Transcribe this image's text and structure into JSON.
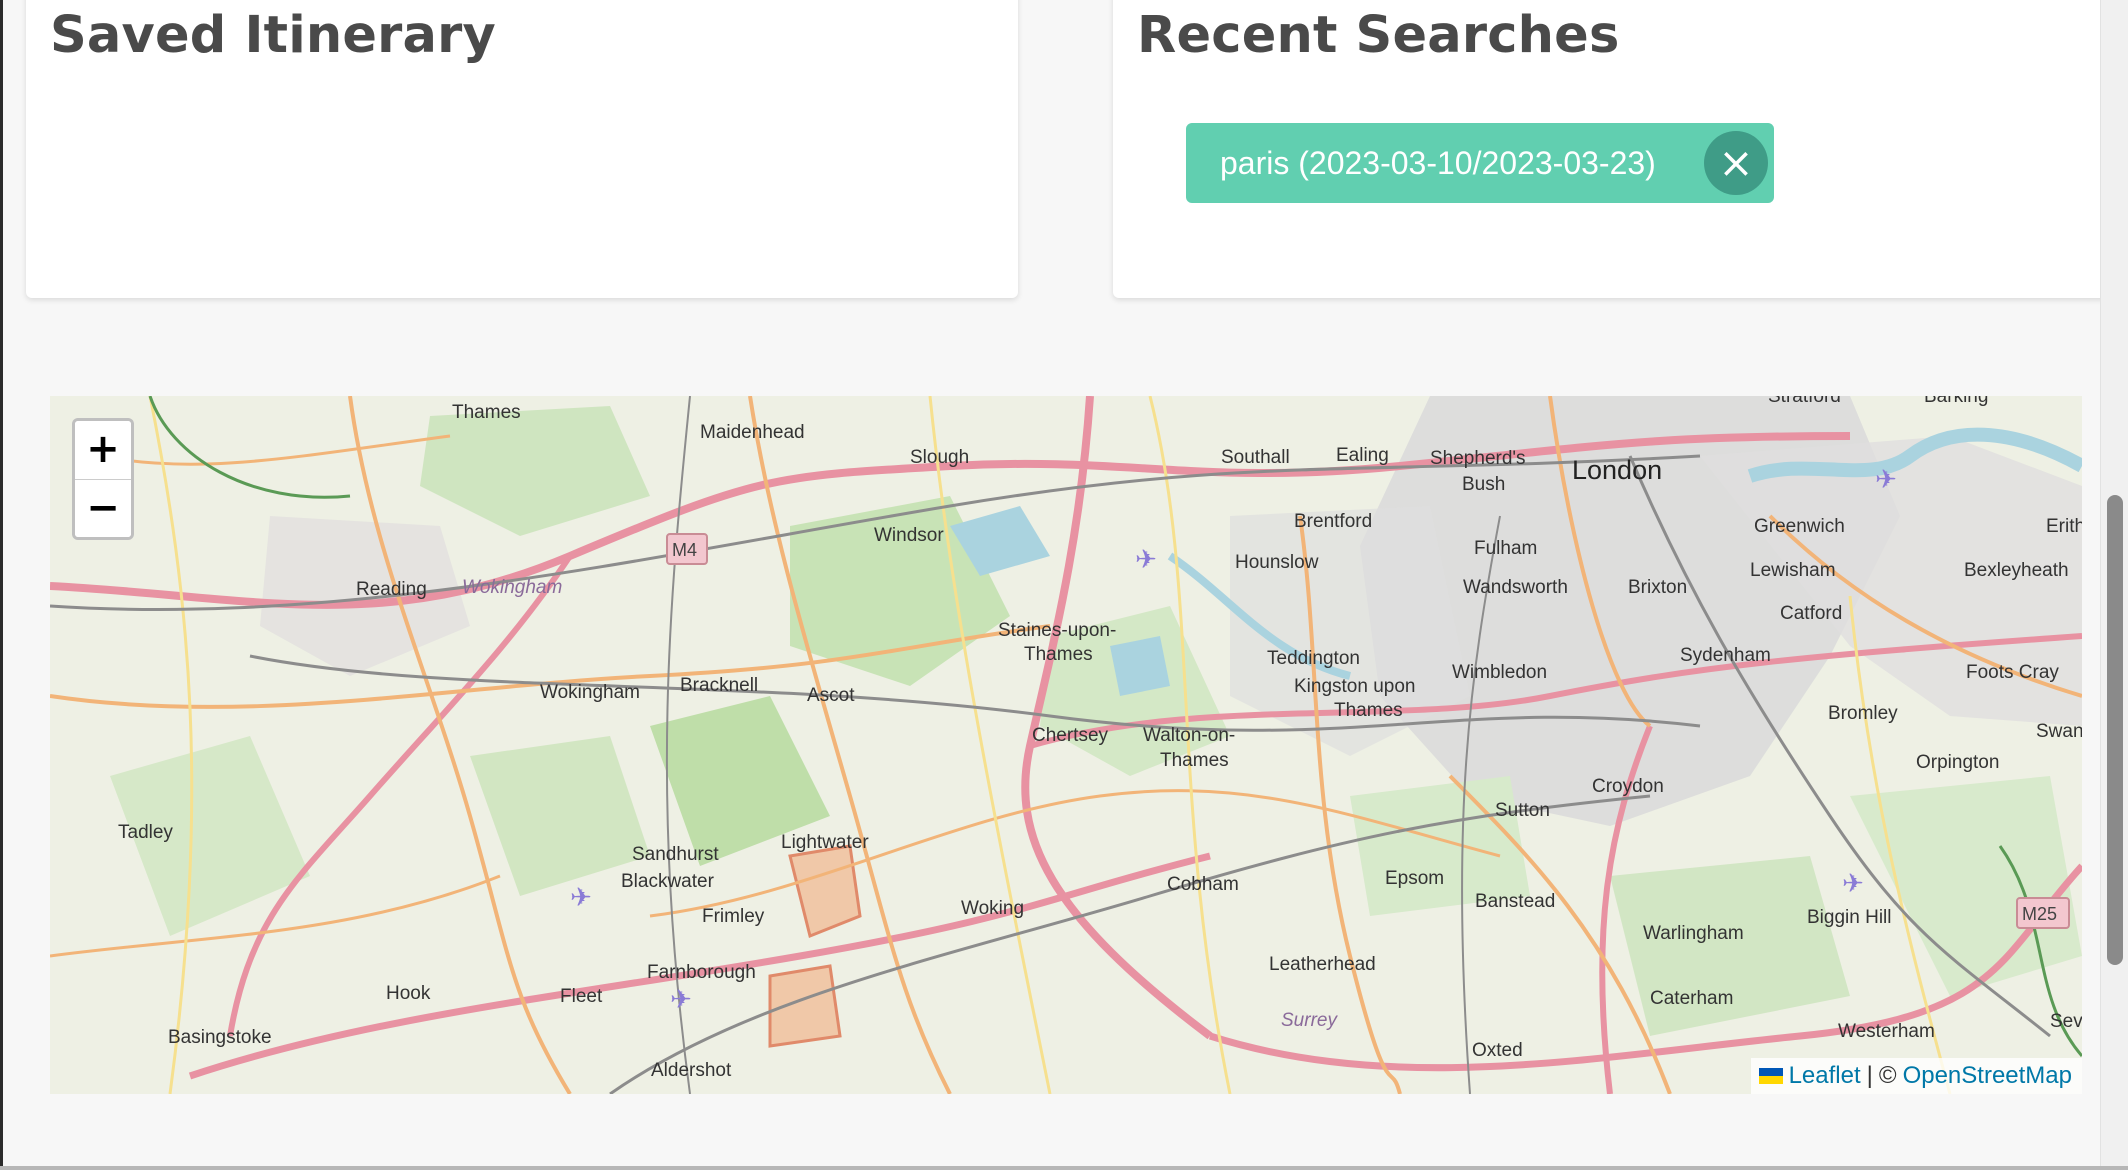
{
  "saved_itinerary": {
    "title": "Saved Itinerary"
  },
  "recent_searches": {
    "title": "Recent Searches",
    "items": [
      {
        "label": "paris (2023-03-10/2023-03-23)",
        "close_icon": "×"
      }
    ]
  },
  "map": {
    "zoom_in": "+",
    "zoom_out": "−",
    "attribution": {
      "leaflet": "Leaflet",
      "separator": "|",
      "copyright": "©",
      "osm": "OpenStreetMap"
    },
    "places": [
      "Thames",
      "Maidenhead",
      "Slough",
      "Southall",
      "Ealing",
      "Shepherd's",
      "Bush",
      "London",
      "Stratford",
      "Barking",
      "Windsor",
      "Brentford",
      "Hounslow",
      "Fulham",
      "Greenwich",
      "Erith",
      "Reading",
      "Wokingham",
      "Wandsworth",
      "Brixton",
      "Lewisham",
      "Bexleyheath",
      "Staines-upon-",
      "Thames",
      "Catford",
      "Teddington",
      "Wimbledon",
      "Sydenham",
      "Foots Cray",
      "Wokingham",
      "Bracknell",
      "Ascot",
      "Kingston upon",
      "Thames",
      "Chertsey",
      "Walton-on-",
      "Thames",
      "Bromley",
      "Swanley",
      "Orpington",
      "Croydon",
      "Tadley",
      "Lightwater",
      "Sutton",
      "Sandhurst",
      "Blackwater",
      "Cobham",
      "Epsom",
      "Banstead",
      "Biggin Hill",
      "Frimley",
      "Woking",
      "Warlingham",
      "M4",
      "M25",
      "Farnborough",
      "Leatherhead",
      "Hook",
      "Fleet",
      "Caterham",
      "Basingstoke",
      "Surrey",
      "Westerham",
      "Seve",
      "Oxted",
      "Aldershot"
    ]
  }
}
